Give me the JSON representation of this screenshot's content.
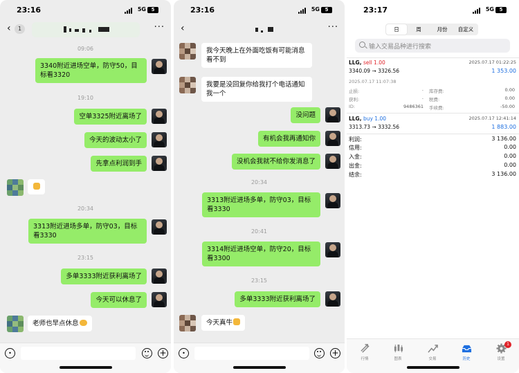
{
  "colors": {
    "wechat_green": "#95ec69",
    "chat_bg": "#ededed",
    "sell_red": "#e0242a",
    "buy_blue": "#1e6fe0"
  },
  "panel1": {
    "status": {
      "time": "23:16",
      "network": "5G",
      "battery": "5"
    },
    "nav": {
      "back_icon": "chevron-left-icon",
      "unread": "1",
      "more": "···"
    },
    "messages": [
      {
        "type": "time",
        "text": "09:06"
      },
      {
        "type": "out",
        "lines": [
          "3340附近进场空单，防守50，目",
          "标看3320"
        ]
      },
      {
        "type": "time",
        "text": "19:10"
      },
      {
        "type": "out",
        "lines": [
          "空单3325附近离场了"
        ]
      },
      {
        "type": "out",
        "lines": [
          "今天的波动太小了"
        ]
      },
      {
        "type": "out",
        "lines": [
          "先拿点利润到手"
        ]
      },
      {
        "type": "in",
        "lines": [
          ""
        ],
        "emoji": "thumbs-up-emoji"
      },
      {
        "type": "time",
        "text": "20:34"
      },
      {
        "type": "out",
        "lines": [
          "3313附近进场多单，防守03，目标",
          "看3330"
        ]
      },
      {
        "type": "time",
        "text": "23:15"
      },
      {
        "type": "out",
        "lines": [
          "多单3333附近获利离场了"
        ]
      },
      {
        "type": "out",
        "lines": [
          "今天可以休息了"
        ]
      },
      {
        "type": "in",
        "lines": [
          "老师也早点休息"
        ],
        "emoji": "handshake-emoji"
      }
    ]
  },
  "panel2": {
    "status": {
      "time": "23:16",
      "network": "5G",
      "battery": "5"
    },
    "nav": {
      "back_icon": "chevron-left-icon",
      "more": "···"
    },
    "messages": [
      {
        "type": "in",
        "lines": [
          "我今天晚上在外面吃饭有可能消息",
          "看不到"
        ]
      },
      {
        "type": "in",
        "lines": [
          "我要是没回复你给我打个电话通知",
          "我一个"
        ]
      },
      {
        "type": "out",
        "lines": [
          "没问题"
        ]
      },
      {
        "type": "out",
        "lines": [
          "有机会我再通知你"
        ]
      },
      {
        "type": "out",
        "lines": [
          "没机会我就不给你发消息了"
        ]
      },
      {
        "type": "time",
        "text": "20:34"
      },
      {
        "type": "out",
        "lines": [
          "3313附近进场多单，防守03，目标",
          "看3330"
        ]
      },
      {
        "type": "time",
        "text": "20:41"
      },
      {
        "type": "out",
        "lines": [
          "3314附近进场空单，防守20，目标",
          "看3300"
        ]
      },
      {
        "type": "time",
        "text": "23:15"
      },
      {
        "type": "out",
        "lines": [
          "多单3333附近获利离场了"
        ]
      },
      {
        "type": "in",
        "lines": [
          "今天真牛"
        ],
        "emoji": "thumbs-up-emoji"
      }
    ]
  },
  "panel3": {
    "status": {
      "time": "23:17",
      "network": "5G",
      "battery": "5"
    },
    "segments": [
      "日",
      "周",
      "月份",
      "自定义"
    ],
    "active_segment": "日",
    "search_placeholder": "输入交易品种进行搜索",
    "trade1": {
      "symbol": "LLG,",
      "side": "sell 1.00",
      "datetime": "2025.07.17 01:22:25",
      "prices": "3340.09 → 3326.56",
      "profit": "1 353.00",
      "open_time": "2025.07.17 11:07:38",
      "details": [
        {
          "l1": "止损:",
          "v1": "-",
          "l2": "库存费:",
          "v2": "0.00"
        },
        {
          "l1": "获利:",
          "v1": "-",
          "l2": "税费:",
          "v2": "0.00"
        },
        {
          "l1": "ID:",
          "v1": "9486361",
          "l2": "手续费:",
          "v2": "-50.00"
        }
      ]
    },
    "trade2": {
      "symbol": "LLG,",
      "side": "buy 1.00",
      "datetime": "2025.07.17 12:41:14",
      "prices": "3313.73 → 3332.56",
      "profit": "1 883.00"
    },
    "summary": [
      {
        "label": "利润:",
        "value": "3 136.00"
      },
      {
        "label": "信用:",
        "value": "0.00"
      },
      {
        "label": "入金:",
        "value": "0.00"
      },
      {
        "label": "出金:",
        "value": "0.00"
      },
      {
        "label": "结余:",
        "value": "3 136.00"
      }
    ],
    "tabs": [
      {
        "label": "行情",
        "icon": "quotes-icon"
      },
      {
        "label": "图表",
        "icon": "chart-icon"
      },
      {
        "label": "交易",
        "icon": "trade-icon"
      },
      {
        "label": "历史",
        "icon": "history-icon"
      },
      {
        "label": "设置",
        "icon": "settings-icon",
        "badge": "1"
      }
    ],
    "active_tab": "历史"
  }
}
